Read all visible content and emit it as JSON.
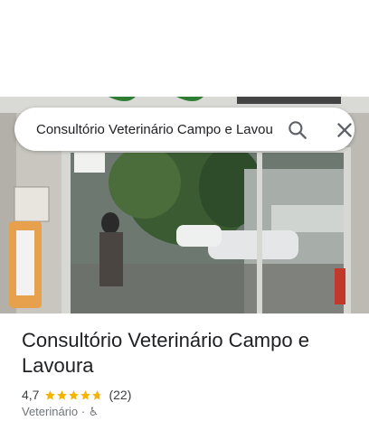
{
  "search": {
    "value": "Consultório Veterinário Campo e Lavoura"
  },
  "icons": {
    "search": "search-icon",
    "close": "close-icon",
    "star": "star-icon"
  },
  "place": {
    "title": "Consultório Veterinário Campo e Lavoura",
    "rating": "4,7",
    "rating_stars": 4.7,
    "review_count": "(22)",
    "category": "Veterinário · ♿"
  },
  "colors": {
    "star": "#f4b400",
    "title": "#202124",
    "secondary": "#70757a"
  }
}
